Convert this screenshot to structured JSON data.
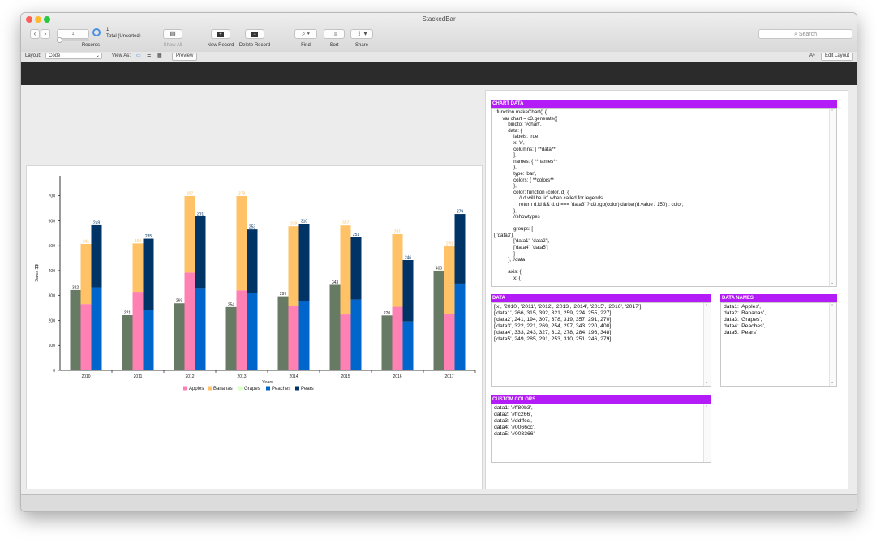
{
  "window": {
    "title": "StackedBar"
  },
  "toolbar": {
    "record_number": "1",
    "record_count": "1",
    "record_status": "Total (Unsorted)",
    "records_label": "Records",
    "show_all_label": "Show All",
    "new_record_label": "New Record",
    "delete_record_label": "Delete Record",
    "find_label": "Find",
    "sort_label": "Sort",
    "share_label": "Share",
    "search_placeholder": "Search"
  },
  "layoutbar": {
    "layout_label": "Layout:",
    "layout_value": "Code",
    "view_as_label": "View As:",
    "preview_label": "Preview",
    "font_icon_text": "Aᴬ",
    "edit_layout_label": "Edit Layout"
  },
  "panels": {
    "chart_data_title": "CHART DATA",
    "chart_data_code": "  function makeChart() {\n      var chart = c3.generate({\n          bindto: '#chart',\n          data: {\n              labels: true,\n              x: 'x',\n              columns: [ **data**\n              ],\n              names: { **names**\n              },\n              type: 'bar',\n              colors: { **colors**\n              },\n              color: function (color, d) {\n                  // d will be 'id' when called for legends\n                  return d.id && d.id === 'data3' ? d3.rgb(color).darker(d.value / 150) : color;\n              },\n              //showtypes\n\n              groups: [\n[ 'data3'],\n              ['data1', 'data2'],\n              ['data4', 'data5']\n              ]\n          }, //data\n\n          axis: {\n              x: {",
    "data_title": "DATA",
    "data_text": "['x', '2010', '2011', '2012', '2013', '2014', '2015', '2016', '2017'],\n['data1', 266, 315, 392, 321, 259, 224, 255, 227],\n['data2', 241, 194, 307, 378, 319, 357, 291, 270],\n['data3', 322, 221, 269, 254, 297, 343, 220, 400],\n['data4', 333, 243, 327, 312, 278, 284, 196, 348],\n['data5', 249, 285, 291, 253, 310, 251, 246, 279]",
    "names_title": "DATA NAMES",
    "names_text": "data1: 'Apples',\ndata2: 'Bananas',\ndata3: 'Grapes',\ndata4: 'Peaches',\ndata5: 'Pears'",
    "colors_title": "CUSTOM COLORS",
    "colors_text": "data1: '#ff80b3',\ndata2: '#ffc266',\ndata3: '#ddffcc',\ndata4: '#0066cc',\ndata5: '#003366'"
  },
  "chart_data": {
    "type": "bar",
    "categories": [
      "2010",
      "2011",
      "2012",
      "2013",
      "2014",
      "2015",
      "2016",
      "2017"
    ],
    "series": [
      {
        "name": "Apples",
        "key": "data1",
        "color": "#ff80b3",
        "values": [
          266,
          315,
          392,
          321,
          259,
          224,
          255,
          227
        ]
      },
      {
        "name": "Bananas",
        "key": "data2",
        "color": "#ffc266",
        "values": [
          241,
          194,
          307,
          378,
          319,
          357,
          291,
          270
        ]
      },
      {
        "name": "Grapes",
        "key": "data3",
        "color": "#ddffcc",
        "values": [
          322,
          221,
          269,
          254,
          297,
          343,
          220,
          400
        ]
      },
      {
        "name": "Peaches",
        "key": "data4",
        "color": "#0066cc",
        "values": [
          333,
          243,
          327,
          312,
          278,
          284,
          196,
          348
        ]
      },
      {
        "name": "Pears",
        "key": "data5",
        "color": "#003366",
        "values": [
          249,
          285,
          291,
          253,
          310,
          251,
          246,
          279
        ]
      }
    ],
    "groups": [
      [
        "data3"
      ],
      [
        "data1",
        "data2"
      ],
      [
        "data4",
        "data5"
      ]
    ],
    "grapes_bar_color": "#677a64",
    "stacked": true,
    "xlabel": "Years",
    "ylabel": "Sales $$",
    "ylim": [
      0,
      700
    ],
    "yticks": [
      0,
      100,
      200,
      300,
      400,
      500,
      600,
      700
    ],
    "legend_position": "bottom",
    "grid": false
  }
}
